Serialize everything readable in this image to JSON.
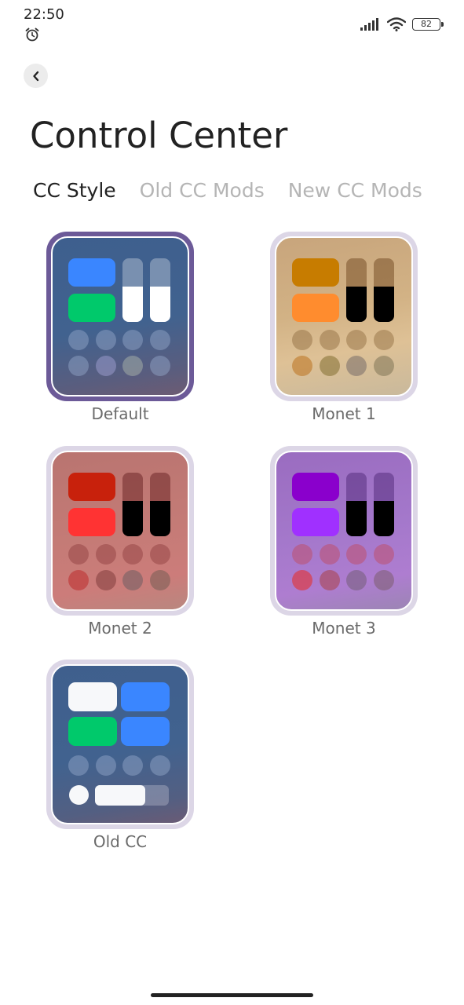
{
  "status_bar": {
    "time": "22:50",
    "battery": "82",
    "icons": [
      "alarm-icon",
      "signal-icon",
      "wifi-icon",
      "battery-icon"
    ]
  },
  "header": {
    "back_icon": "chevron-left-icon",
    "title": "Control Center"
  },
  "tabs": [
    {
      "label": "CC Style",
      "active": true
    },
    {
      "label": "Old CC Mods",
      "active": false
    },
    {
      "label": "New CC Mods",
      "active": false
    }
  ],
  "styles": [
    {
      "label": "Default",
      "selected": true
    },
    {
      "label": "Monet 1",
      "selected": false
    },
    {
      "label": "Monet 2",
      "selected": false
    },
    {
      "label": "Monet 3",
      "selected": false
    },
    {
      "label": "Old CC",
      "selected": false
    }
  ],
  "colors": {
    "selected_border": "#6c5a98",
    "unselected_border": "#dcd6e6",
    "default_tile_blue": "#3a86ff",
    "default_tile_green": "#00c96b",
    "monet1_tile_a": "#c77c00",
    "monet1_tile_b": "#ff8c2e",
    "monet2_tile_a": "#c8210c",
    "monet2_tile_b": "#ff3333",
    "monet3_tile_a": "#8a00cc",
    "monet3_tile_b": "#a030ff"
  }
}
